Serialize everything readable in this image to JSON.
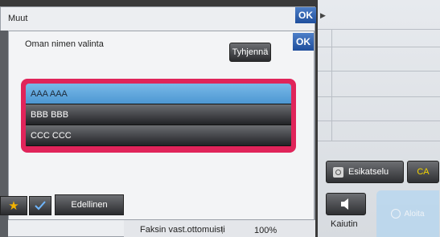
{
  "outer_dialog": {
    "title": "Muut",
    "ok_label": "OK"
  },
  "inner_dialog": {
    "title": "Oman nimen valinta",
    "ok_label": "OK",
    "clear_label": "Tyhjennä",
    "list": [
      {
        "label": "AAA AAA",
        "selected": true
      },
      {
        "label": "BBB BBB",
        "selected": false
      },
      {
        "label": "CCC CCC",
        "selected": false
      }
    ]
  },
  "right_panel": {
    "preview_label": "Esikatselu",
    "ca_label": "CA",
    "speaker_label": "Kaiutin",
    "start_label": "Aloita"
  },
  "bottom": {
    "previous_label": "Edellinen",
    "fax_status": "Faksin vast.ottomuisti",
    "fax_percent": "100%"
  },
  "colors": {
    "accent_ok": "#2b5fb3",
    "highlight_frame": "#e0245a",
    "selected_item": "#5ea6dc",
    "ca_text": "#f2d400"
  },
  "icons": [
    "play-icon",
    "preview-icon",
    "speaker-icon",
    "start-icon",
    "star-icon",
    "check-icon"
  ]
}
